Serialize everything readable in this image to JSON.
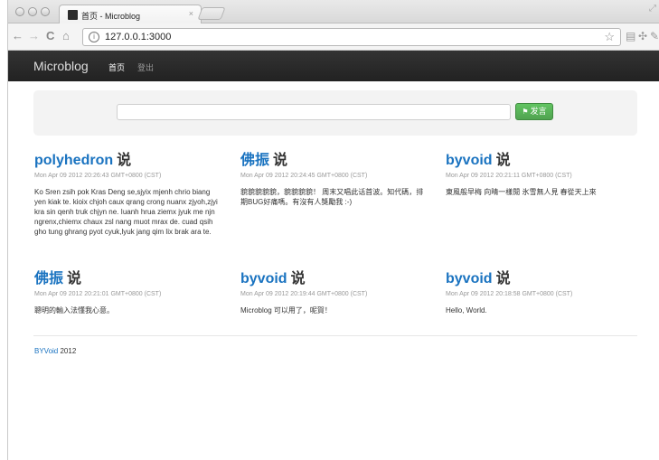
{
  "browser": {
    "tab_title": "首页 - Microblog",
    "tab_close": "×",
    "url": "127.0.0.1:3000",
    "nav": {
      "back": "←",
      "forward": "→",
      "reload": "C",
      "home": "⌂"
    },
    "toolbar_icons": [
      "page-icon",
      "puzzle-icon",
      "wrench-icon"
    ]
  },
  "navbar": {
    "brand": "Microblog",
    "links": [
      {
        "label": "首页",
        "active": true
      },
      {
        "label": "登出",
        "active": false
      }
    ]
  },
  "composer": {
    "input_value": "",
    "button_label": "发言",
    "button_icon": "flag-icon"
  },
  "posts": [
    {
      "user": "polyhedron",
      "verb": "说",
      "time": "Mon Apr 09 2012 20:26:43 GMT+0800 (CST)",
      "text": "Ko Sren zsih pok Kras Deng se,sjyix mjenh chrio biang yen kiak te. kioix chjoh caux qrang crong nuanx zjyoh,zjyi kra sin qenh truk chjyn ne. Iuanh hrua ziemx jyuk me njn ngrenx,chiemx chaux zsl nang muot mrax de. cuad qsih gho tung ghrang pyot cyuk,lyuk jang qim lix brak ara te."
    },
    {
      "user": "佛振",
      "verb": "说",
      "time": "Mon Apr 09 2012 20:24:45 GMT+0800 (CST)",
      "text": "貌貌貌貌貌，貌貌貌貌！ 周末又唱此话首波。知代碼，排期BUG好痛嗎。有沒有人獎勵我 :-)"
    },
    {
      "user": "byvoid",
      "verb": "说",
      "time": "Mon Apr 09 2012 20:21:11 GMT+0800 (CST)",
      "text": "東風般早梅 向晴一樣閒 氷雪無人見 春從天上來"
    },
    {
      "user": "佛振",
      "verb": "说",
      "time": "Mon Apr 09 2012 20:21:01 GMT+0800 (CST)",
      "text": "聰明的輸入法懂我心意。"
    },
    {
      "user": "byvoid",
      "verb": "说",
      "time": "Mon Apr 09 2012 20:19:44 GMT+0800 (CST)",
      "text": "Microblog 可以用了，呢賀！"
    },
    {
      "user": "byvoid",
      "verb": "说",
      "time": "Mon Apr 09 2012 20:18:58 GMT+0800 (CST)",
      "text": "Hello, World."
    }
  ],
  "footer": {
    "link": "BYVoid",
    "year": "2012"
  }
}
